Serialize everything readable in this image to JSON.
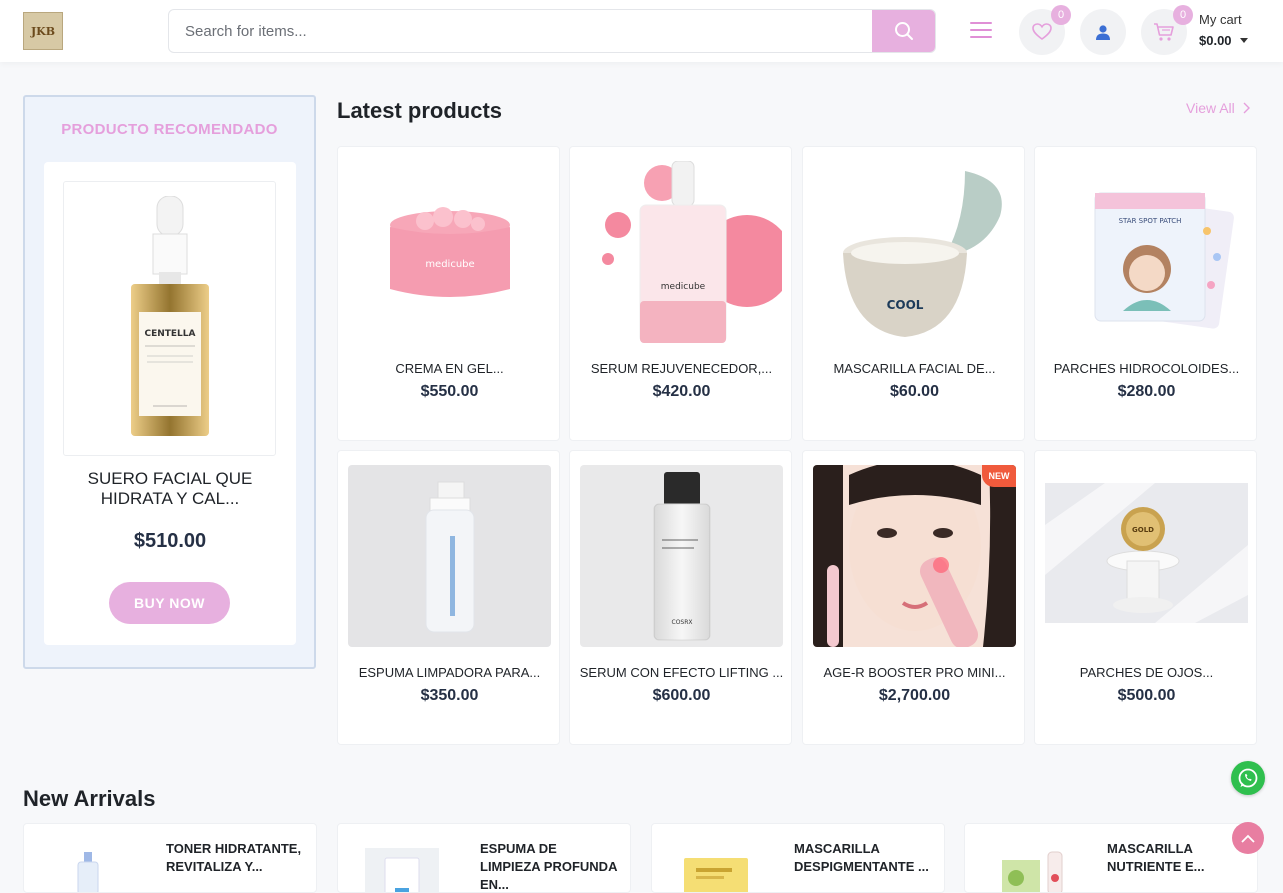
{
  "header": {
    "logo_text": "JKB",
    "search_placeholder": "Search for items...",
    "wishlist_count": "0",
    "cart_count": "0",
    "cart_label": "My cart",
    "cart_total": "$0.00"
  },
  "recommended": {
    "title": "PRODUCTO RECOMENDADO",
    "product_name": "SUERO FACIAL QUE HIDRATA Y CAL...",
    "price": "$510.00",
    "buy_label": "BUY NOW",
    "image_brand": "CENTELLA"
  },
  "latest": {
    "title": "Latest products",
    "view_all": "View All",
    "products": [
      {
        "name": "CREMA EN GEL...",
        "price": "$550.00",
        "image": "medicube-gel-jar",
        "brand": "medicube"
      },
      {
        "name": "SERUM REJUVENECEDOR,...",
        "price": "$420.00",
        "image": "medicube-serum-bottle",
        "brand": "medicube"
      },
      {
        "name": "MASCARILLA FACIAL DE...",
        "price": "$60.00",
        "image": "cool-mask-bowl",
        "brand": "COOL"
      },
      {
        "name": "PARCHES HIDROCOLOIDES...",
        "price": "$280.00",
        "image": "star-spot-patch",
        "brand": "STAR SPOT PATCH"
      },
      {
        "name": "ESPUMA LIMPADORA PARA...",
        "price": "$350.00",
        "image": "foam-cleanser-bottle",
        "brand": ""
      },
      {
        "name": "SERUM CON EFECTO LIFTING ...",
        "price": "$600.00",
        "image": "lifting-serum-spray",
        "brand": "COSRX"
      },
      {
        "name": "AGE-R BOOSTER PRO MINI...",
        "price": "$2,700.00",
        "image": "booster-device-model",
        "badge": "NEW"
      },
      {
        "name": "PARCHES DE OJOS...",
        "price": "$500.00",
        "image": "gold-eye-patch-jar",
        "brand": "GOLD"
      }
    ]
  },
  "arrivals": {
    "title": "New Arrivals",
    "items": [
      {
        "name": "TONER HIDRATANTE, REVITALIZA Y..."
      },
      {
        "name": "ESPUMA DE LIMPIEZA PROFUNDA EN..."
      },
      {
        "name": "MASCARILLA DESPIGMENTANTE ..."
      },
      {
        "name": "MASCARILLA NUTRIENTE E..."
      }
    ]
  },
  "colors": {
    "accent": "#e7b0df",
    "accent_text": "#e59fdc",
    "whatsapp": "#2fbf4e",
    "scroll_top": "#e87ea1"
  }
}
